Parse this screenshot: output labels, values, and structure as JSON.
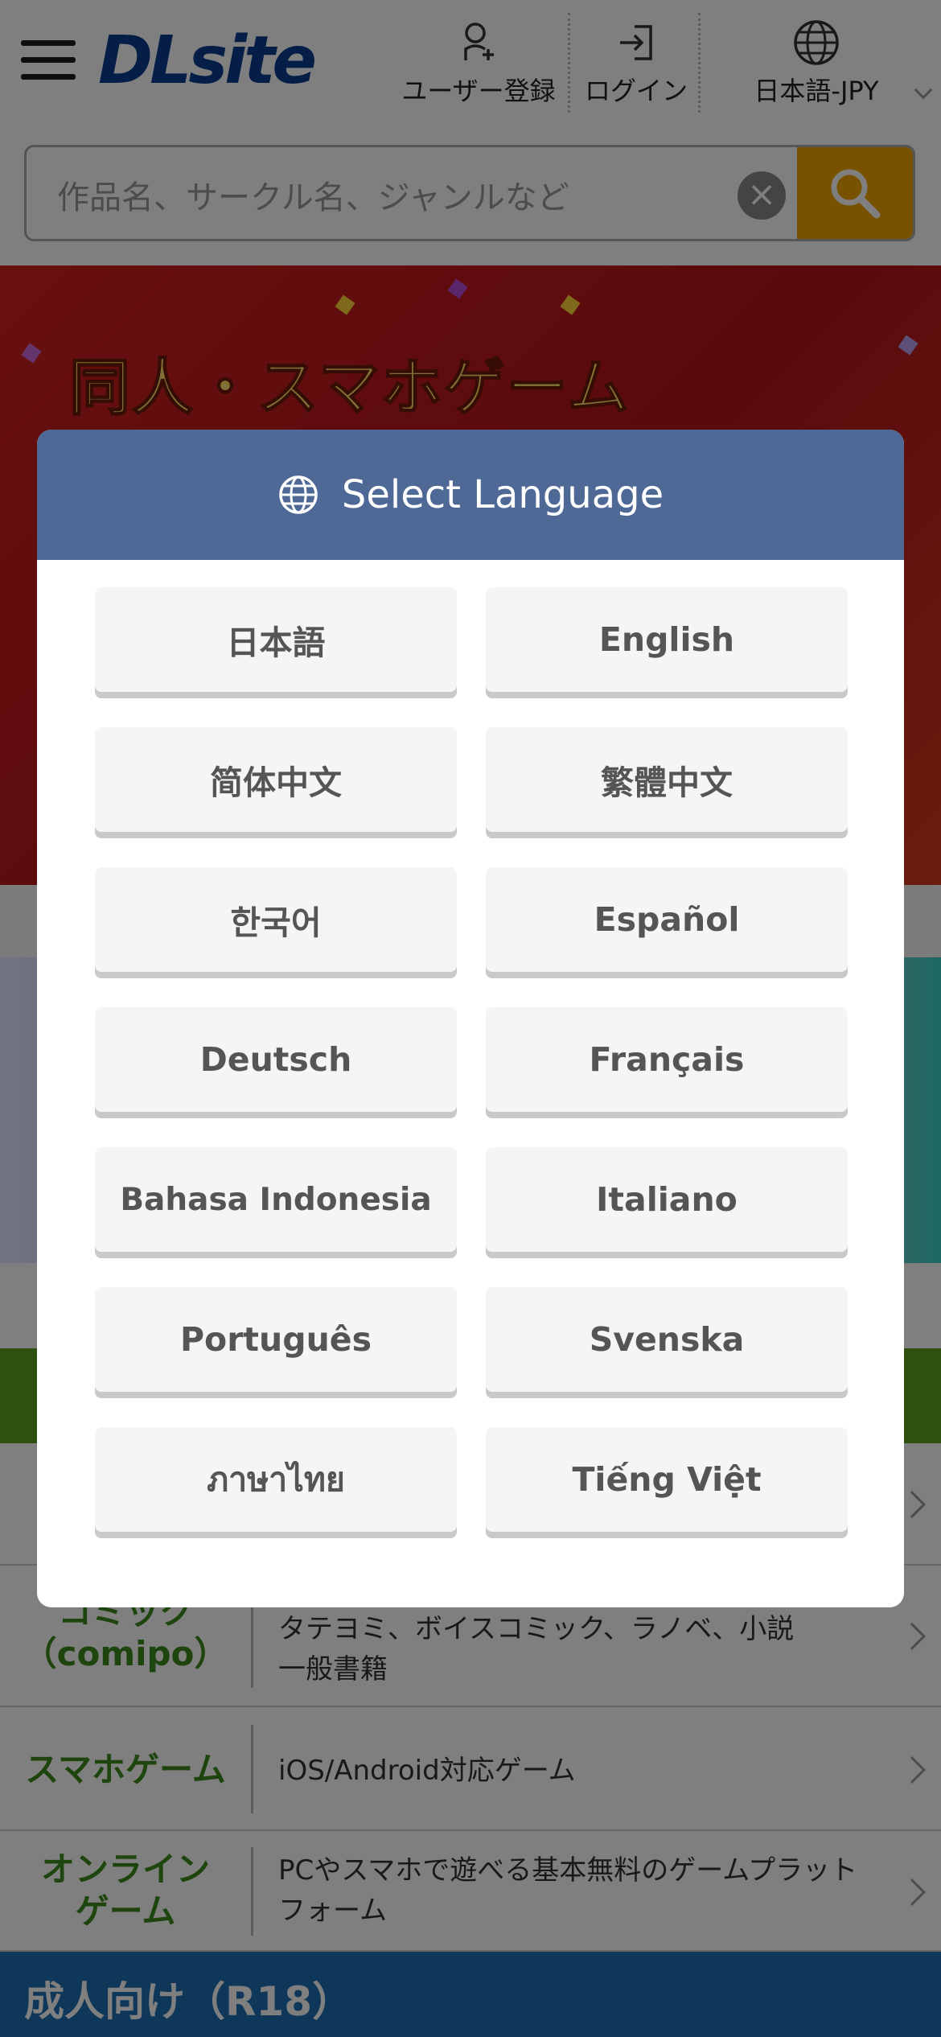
{
  "header": {
    "logo": "DLsite",
    "register_label": "ユーザー登録",
    "login_label": "ログイン",
    "language_label": "日本語-JPY"
  },
  "search": {
    "placeholder": "作品名、サークル名、ジャンルなど",
    "clear_symbol": "×"
  },
  "banner": {
    "title": "同人・スマホゲーム"
  },
  "categories": [
    {
      "name": "コミック（comipo）",
      "name_line1": "コミック",
      "name_line2": "（comipo）",
      "desc_line1": "タテヨミ、ボイスコミック、ラノベ、小説",
      "desc_line2": "一般書籍"
    },
    {
      "name": "スマホゲーム",
      "desc_line1": "iOS/Android対応ゲーム"
    },
    {
      "name": "オンラインゲーム",
      "name_line1": "オンライン",
      "name_line2": "ゲーム",
      "desc_line1": "PCやスマホで遊べる基本無料のゲームプラット",
      "desc_line2": "フォーム"
    }
  ],
  "adult_section": "成人向け（R18）",
  "modal": {
    "title": "Select Language",
    "languages": [
      "日本語",
      "English",
      "简体中文",
      "繁體中文",
      "한국어",
      "Español",
      "Deutsch",
      "Français",
      "Bahasa Indonesia",
      "Italiano",
      "Português",
      "Svenska",
      "ภาษาไทย",
      "Tiếng Việt"
    ]
  },
  "colors": {
    "brand": "#0b3d91",
    "search_button": "#f2a400",
    "modal_header": "#4f6996",
    "category_green": "#5ea321",
    "adult_blue": "#1d6fb4"
  }
}
